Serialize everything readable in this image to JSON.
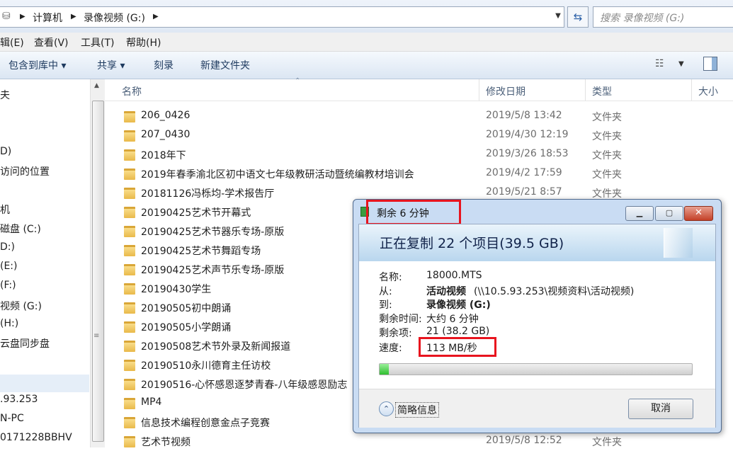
{
  "address": {
    "segments": [
      "计算机",
      "录像视频 (G:)"
    ],
    "search_placeholder": "搜索 录像视频 (G:)"
  },
  "menu": [
    "辑(E)",
    "查看(V)",
    "工具(T)",
    "帮助(H)"
  ],
  "toolbar": {
    "include_library": "包含到库中 ▾",
    "share": "共享 ▾",
    "burn": "刻录",
    "new_folder": "新建文件夹"
  },
  "nav": [
    "夫",
    "D)",
    "访问的位置",
    "机",
    "磁盘 (C:)",
    "D:)",
    "(E:)",
    "(F:)",
    "视频 (G:)",
    "(H:)",
    "云盘同步盘",
    ".93.253",
    "N-PC",
    "0171228BBHV"
  ],
  "columns": {
    "name": "名称",
    "date": "修改日期",
    "type": "类型",
    "size": "大小"
  },
  "rows": [
    {
      "name": "206_0426",
      "date": "2019/5/8 13:42",
      "type": "文件夹"
    },
    {
      "name": "207_0430",
      "date": "2019/4/30 12:19",
      "type": "文件夹"
    },
    {
      "name": "2018年下",
      "date": "2019/3/26 18:53",
      "type": "文件夹"
    },
    {
      "name": "2019年春季渝北区初中语文七年级教研活动暨统编教材培训会",
      "date": "2019/4/2 17:59",
      "type": "文件夹"
    },
    {
      "name": "20181126冯栎均-学术报告厅",
      "date": "2019/5/21 8:57",
      "type": "文件夹"
    },
    {
      "name": "20190425艺术节开幕式",
      "date": "",
      "type": ""
    },
    {
      "name": "20190425艺术节器乐专场-原版",
      "date": "",
      "type": ""
    },
    {
      "name": "20190425艺术节舞蹈专场",
      "date": "",
      "type": ""
    },
    {
      "name": "20190425艺术声节乐专场-原版",
      "date": "",
      "type": ""
    },
    {
      "name": "20190430学生",
      "date": "",
      "type": ""
    },
    {
      "name": "20190505初中朗诵",
      "date": "",
      "type": ""
    },
    {
      "name": "20190505小学朗诵",
      "date": "",
      "type": ""
    },
    {
      "name": "20190508艺术节外录及新闻报道",
      "date": "",
      "type": ""
    },
    {
      "name": "20190510永川德育主任访校",
      "date": "",
      "type": ""
    },
    {
      "name": "20190516-心怀感恩逐梦青春-八年级感恩励志",
      "date": "",
      "type": ""
    },
    {
      "name": "MP4",
      "date": "",
      "type": ""
    },
    {
      "name": "信息技术编程创意金点子竞赛",
      "date": "",
      "type": ""
    },
    {
      "name": "艺术节视频",
      "date": "2019/5/8 12:52",
      "type": "文件夹"
    }
  ],
  "dialog": {
    "title": "剩余 6 分钟",
    "heading": "正在复制 22 个项目(39.5 GB)",
    "name_label": "名称:",
    "name_value": "18000.MTS",
    "from_label": "从:",
    "from_bold": "活动视频",
    "from_rest": " (\\\\10.5.93.253\\视频资料\\活动视频)",
    "to_label": "到:",
    "to_value": "录像视频 (G:)",
    "time_label": "剩余时间:",
    "time_value": "大约 6 分钟",
    "items_label": "剩余项:",
    "items_value": "21 (38.2 GB)",
    "speed_label": "速度:",
    "speed_value": "113 MB/秒",
    "progress": 0.03,
    "more_info": "简略信息",
    "cancel": "取消"
  },
  "colors": {
    "highlight": "#e8141e",
    "progress": "#2fbe2f"
  }
}
